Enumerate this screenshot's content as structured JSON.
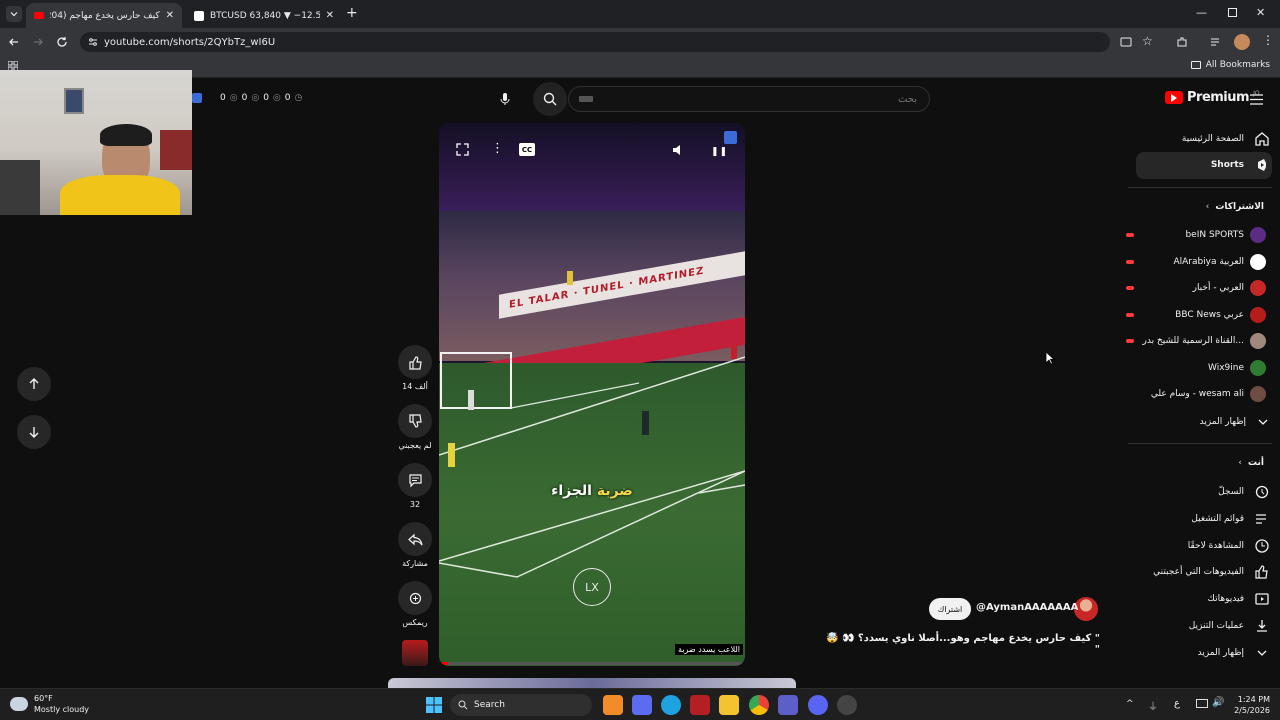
{
  "browser": {
    "tabs": [
      {
        "title": "كيف حارس يخدع مهاجم (204) *",
        "active": true
      },
      {
        "title": "BTCUSD 63,840 ▼ −12.55% ab",
        "active": false
      }
    ],
    "new_tab": "+",
    "url": "youtube.com/shorts/2QYbTz_wI6U",
    "all_bookmarks": "All Bookmarks"
  },
  "overlay": {
    "counters": [
      "0",
      "0",
      "0",
      "0"
    ]
  },
  "youtube": {
    "search_placeholder": "بحث",
    "logo": "Premium",
    "logo_region": "JO",
    "nav": [
      {
        "label": "الصفحة الرئيسية",
        "icon": "home-icon"
      },
      {
        "label": "Shorts",
        "icon": "shorts-icon",
        "active": true
      }
    ],
    "subscriptions_title": "الاشتراكات",
    "subscriptions": [
      {
        "name": "beIN SPORTS",
        "color": "#5b2c83",
        "live": true
      },
      {
        "name": "AlArabiya العربية",
        "color": "#ffffff",
        "live": true
      },
      {
        "name": "العربي - أخبار",
        "color": "#c62828",
        "live": true
      },
      {
        "name": "BBC News عربي",
        "color": "#b71c1c",
        "live": true
      },
      {
        "name": "القناة الرسمية للشيخ بدر...",
        "color": "#a1887f",
        "live": true
      },
      {
        "name": "Wix9ine",
        "color": "#2e7d32",
        "live": false
      },
      {
        "name": "وسام علي - wesam ali",
        "color": "#6d4c41",
        "live": false
      }
    ],
    "show_more": "إظهار المزيد",
    "you_title": "أنت",
    "you_items": [
      {
        "label": "السجلّ",
        "icon": "history-icon"
      },
      {
        "label": "قوائم التشغيل",
        "icon": "playlist-icon"
      },
      {
        "label": "المشاهدة لاحقًا",
        "icon": "clock-icon"
      },
      {
        "label": "الفيديوهات التي أعجبتني",
        "icon": "like-icon"
      },
      {
        "label": "فيديوهاتك",
        "icon": "video-icon"
      },
      {
        "label": "عمليات التنزيل",
        "icon": "download-icon"
      },
      {
        "label": "إظهار المزيد",
        "icon": "chevron-down-icon"
      }
    ],
    "short": {
      "caption": "ضربة الجزاء",
      "caption_highlight": "ضربة",
      "subtitle": "اللاعب يسدد ضربة",
      "watermark": "LX",
      "channel": "@AymanAAAAAAA",
      "subscribe": "اشتراك",
      "title": "\" كيف حارس يخدع مهاجم وهو...أصلا ناوي يسدد؟ 👀 🤯 \"",
      "likes": "14 ألف",
      "dislike": "لم يعجبني",
      "comments": "32",
      "share": "مشاركة",
      "remix": "ريمكس",
      "progress": 0.03
    }
  },
  "taskbar": {
    "weather_temp": "60°F",
    "weather_desc": "Mostly cloudy",
    "search": "Search",
    "lang": "ع",
    "time": "1:24 PM",
    "date": "2/5/2026"
  }
}
